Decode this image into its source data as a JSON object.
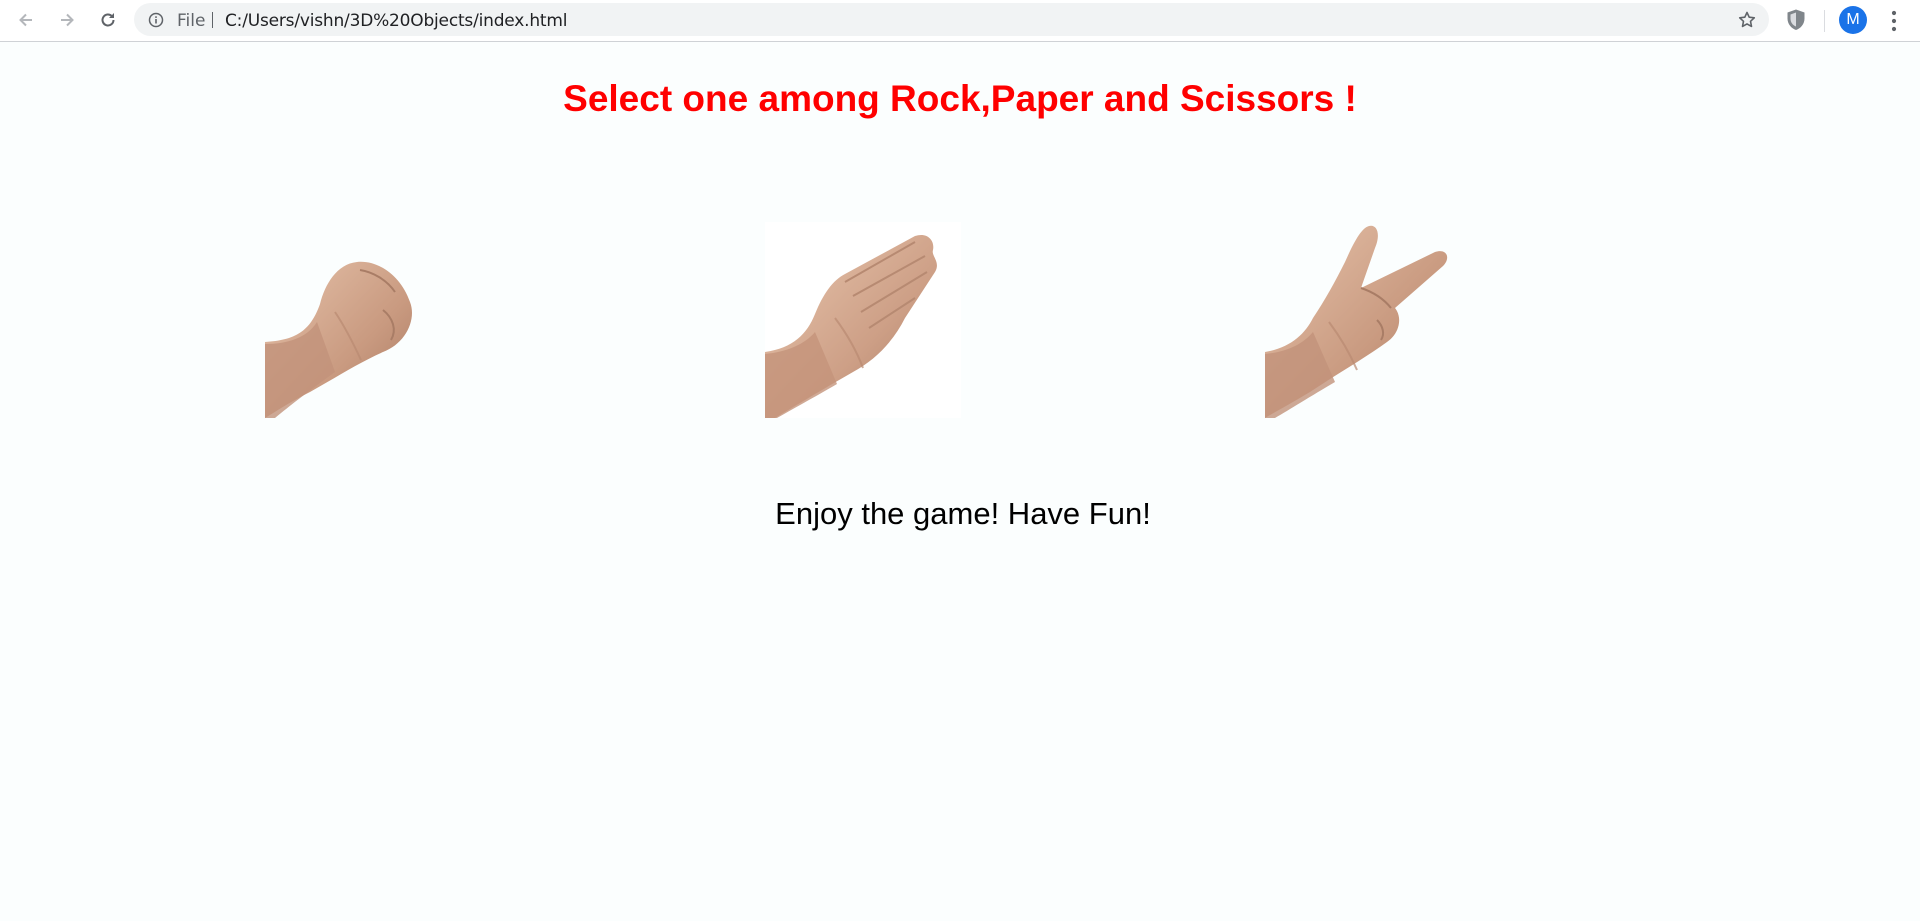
{
  "browser": {
    "scheme_label": "File",
    "url": "C:/Users/vishn/3D%20Objects/index.html",
    "avatar_letter": "M",
    "icons": {
      "back": "arrow-left-icon",
      "forward": "arrow-right-icon",
      "reload": "reload-icon",
      "info": "info-icon",
      "bookmark": "star-icon",
      "extension": "shield-icon",
      "menu": "kebab-menu-icon"
    }
  },
  "page": {
    "title": "Select one among Rock,Paper and Scissors !",
    "title_color": "#ff0000",
    "background_color": "#fbfefe",
    "choices": [
      {
        "id": "rock",
        "image": "fist-hand-image"
      },
      {
        "id": "paper",
        "image": "flat-hand-image"
      },
      {
        "id": "scissors",
        "image": "v-sign-hand-image"
      }
    ],
    "footer": "Enjoy the game! Have Fun!"
  }
}
